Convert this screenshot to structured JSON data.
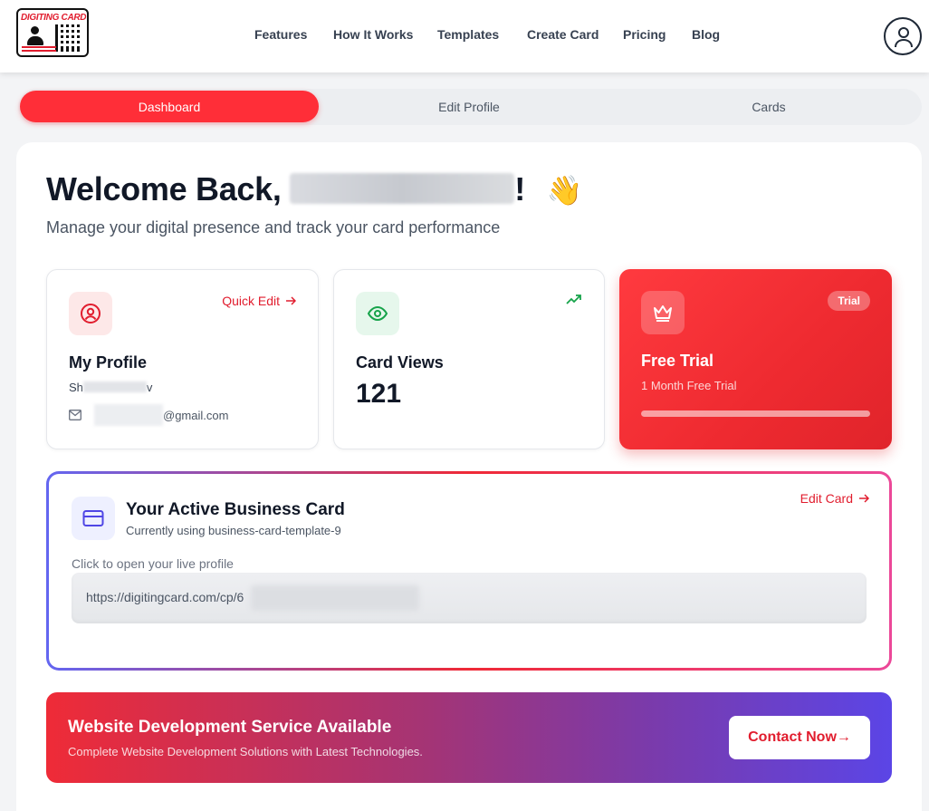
{
  "header": {
    "logo_text": "DIGITING CARD",
    "nav": [
      "Features",
      "How It Works",
      "Templates",
      "Create Card",
      "Pricing",
      "Blog"
    ]
  },
  "tabs": [
    "Dashboard",
    "Edit Profile",
    "Cards"
  ],
  "welcome": {
    "prefix": "Welcome Back,",
    "suffix": "!",
    "wave": "👋",
    "subtitle": "Manage your digital presence and track your card performance"
  },
  "profile_card": {
    "quick_edit": "Quick Edit",
    "title": "My Profile",
    "name_start": "Sh",
    "name_end": "v",
    "email_suffix": "@gmail.com"
  },
  "views_card": {
    "title": "Card Views",
    "value": "121"
  },
  "trial_card": {
    "badge": "Trial",
    "title": "Free Trial",
    "subtitle": "1 Month Free Trial",
    "progress": 1.0
  },
  "active_card": {
    "title": "Your Active Business Card",
    "subtitle": "Currently using business-card-template-9",
    "edit": "Edit Card",
    "live_label": "Click to open your live profile",
    "url": "https://digitingcard.com/cp/6"
  },
  "banner": {
    "title": "Website Development Service Available",
    "subtitle": "Complete Website Development Solutions with Latest Technologies.",
    "button": "Contact Now→"
  },
  "colors": {
    "accent": "#ff2e38",
    "views_green": "#16a34a",
    "card_blue": "#4f46e5"
  }
}
